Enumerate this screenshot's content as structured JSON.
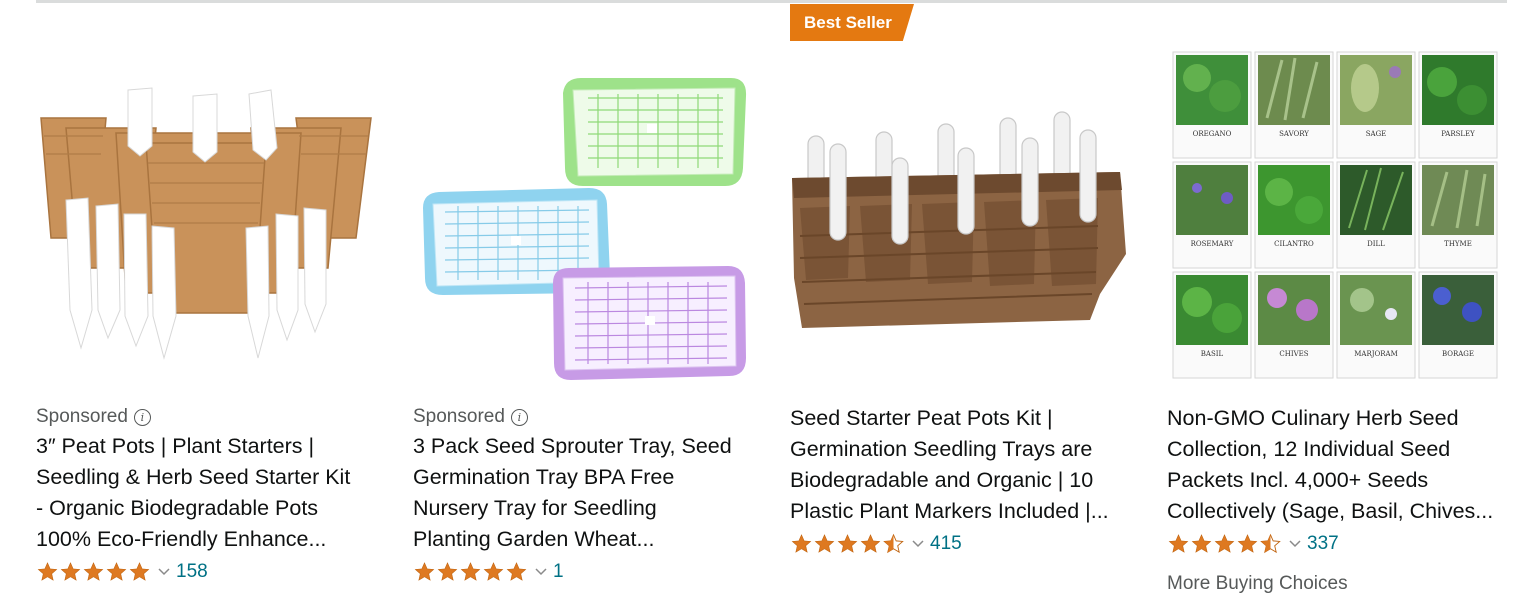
{
  "colors": {
    "star": "#de7921",
    "link": "#007185",
    "badge": "#e47911",
    "muted": "#565959"
  },
  "products": [
    {
      "sponsored_label": "Sponsored",
      "info_icon": "info-icon",
      "title": "3″ Peat Pots | Plant Starters |\nSeedling & Herb Seed Starter Kit\n- Organic Biodegradable Pots\n100% Eco-Friendly Enhance...",
      "rating": 5,
      "review_count": "158"
    },
    {
      "sponsored_label": "Sponsored",
      "info_icon": "info-icon",
      "title": "3 Pack Seed Sprouter Tray, Seed\nGermination Tray BPA Free\nNursery Tray for Seedling\nPlanting Garden Wheat...",
      "rating": 5,
      "review_count": "1"
    },
    {
      "badge": "Best Seller",
      "title": "Seed Starter Peat Pots Kit |\nGermination Seedling Trays are\nBiodegradable and Organic | 10\nPlastic Plant Markers Included |...",
      "rating": 4.5,
      "review_count": "415"
    },
    {
      "title": "Non-GMO Culinary Herb Seed\nCollection, 12 Individual Seed\nPackets Incl. 4,000+ Seeds\nCollectively (Sage, Basil, Chives...",
      "rating": 4.5,
      "review_count": "337",
      "more_choices": "More Buying Choices"
    }
  ],
  "herb_packets": [
    "OREGANO",
    "SAVORY",
    "SAGE",
    "PARSLEY",
    "ROSEMARY",
    "CILANTRO",
    "DILL",
    "THYME",
    "BASIL",
    "CHIVES",
    "MARJORAM",
    "BORAGE"
  ]
}
